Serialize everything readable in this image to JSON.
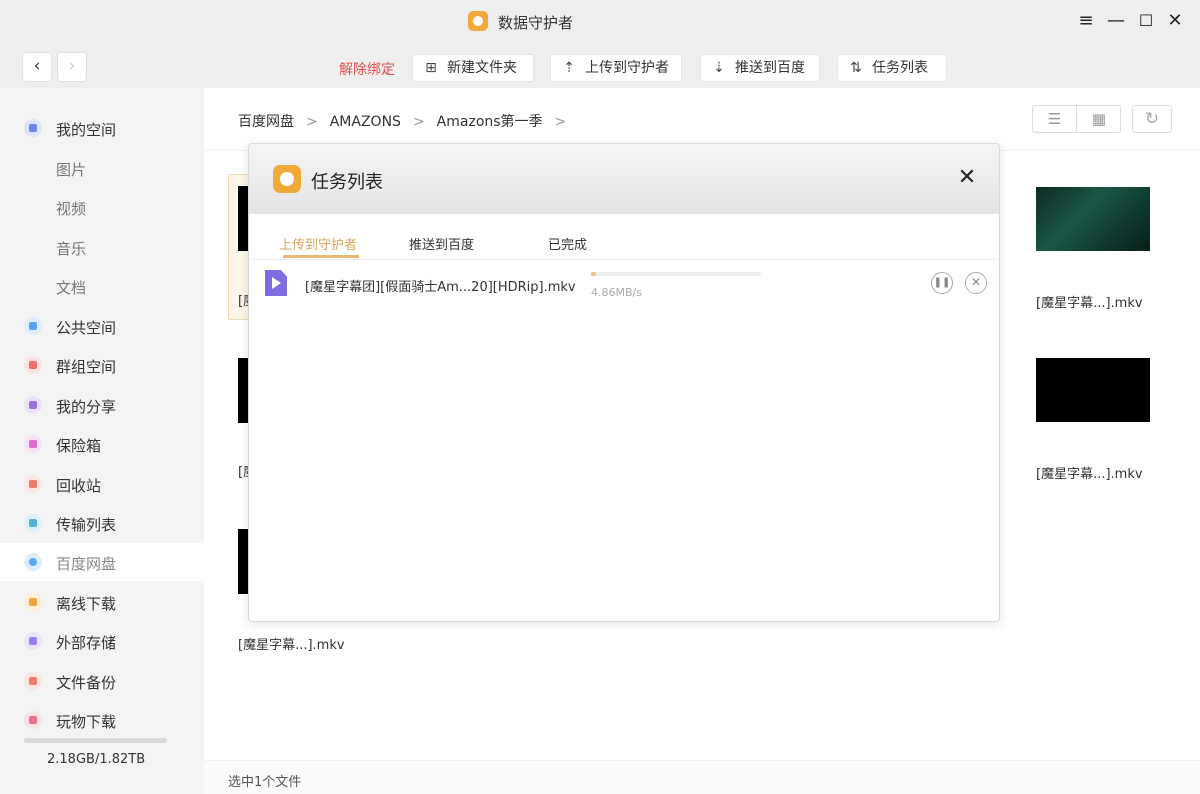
{
  "window": {
    "title": "数据守护者",
    "controls": [
      "≡",
      "—",
      "☐",
      "✕"
    ]
  },
  "toolbar": {
    "unbind_label": "解除绑定",
    "new_folder_label": "新建文件夹",
    "upload_label": "上传到守护者",
    "push_label": "推送到百度",
    "task_list_label": "任务列表",
    "accent_color": "#e2504a"
  },
  "sidebar": {
    "items": [
      {
        "label": "我的空间",
        "icon": "my-space-icon",
        "color": "#6b86e8"
      },
      {
        "label": "图片"
      },
      {
        "label": "视频"
      },
      {
        "label": "音乐"
      },
      {
        "label": "文档"
      },
      {
        "label": "公共空间",
        "icon": "send-icon",
        "color": "#5aa2ef"
      },
      {
        "label": "群组空间",
        "icon": "group-icon",
        "color": "#ef6f6f"
      },
      {
        "label": "我的分享",
        "icon": "share-icon",
        "color": "#9b6fd8"
      },
      {
        "label": "保险箱",
        "icon": "safe-icon",
        "color": "#d96fcf"
      },
      {
        "label": "回收站",
        "icon": "trash-icon",
        "color": "#ef7b6a"
      },
      {
        "label": "传输列表",
        "icon": "transfer-icon",
        "color": "#55b0d8"
      },
      {
        "label": "百度网盘",
        "icon": "baidu-cloud-icon",
        "color": "#5aa6ef"
      },
      {
        "label": "离线下载",
        "icon": "download-icon",
        "color": "#f0a642"
      },
      {
        "label": "外部存储",
        "icon": "usb-icon",
        "color": "#9a7ef0"
      },
      {
        "label": "文件备份",
        "icon": "backup-icon",
        "color": "#ef7b6a"
      },
      {
        "label": "玩物下载",
        "icon": "wanwu-icon",
        "color": "#e86f8e"
      }
    ],
    "storage": "2.18GB/1.82TB",
    "active_index": 11
  },
  "breadcrumb": [
    "百度网盘",
    "AMAZONS",
    "Amazons第一季"
  ],
  "files": {
    "visible_names": [
      "[魔星字幕...].mkv",
      "[魔星字幕...].mkv",
      "[魔星字幕...].mkv"
    ],
    "partial_prefix": "[魔"
  },
  "footer": {
    "status": "选中1个文件"
  },
  "dialog": {
    "title": "任务列表",
    "tabs": [
      "上传到守护者",
      "推送到百度",
      "已完成"
    ],
    "active_tab": 0,
    "tasks": [
      {
        "name": "[魔星字幕团][假面骑士Am...20][HDRip].mkv",
        "speed": "4.86MB/s",
        "progress": 0.03
      }
    ]
  }
}
